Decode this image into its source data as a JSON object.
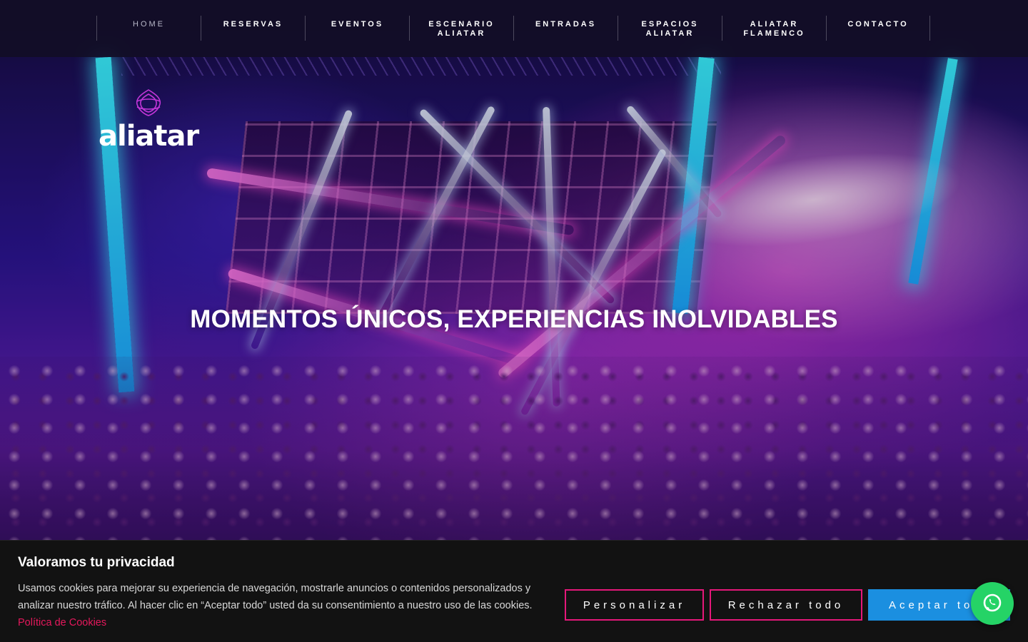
{
  "nav": {
    "items": [
      {
        "label": "HOME",
        "active": true
      },
      {
        "label": "RESERVAS",
        "active": false
      },
      {
        "label": "EVENTOS",
        "active": false
      },
      {
        "label": "ESCENARIO\nALIATAR",
        "active": false
      },
      {
        "label": "ENTRADAS",
        "active": false
      },
      {
        "label": "ESPACIOS\nALIATAR",
        "active": false
      },
      {
        "label": "ALIATAR\nFLAMENCO",
        "active": false
      },
      {
        "label": "CONTACTO",
        "active": false
      }
    ]
  },
  "logo": {
    "text": "aliatar",
    "mark_color": "#c236d8"
  },
  "hero": {
    "headline": "MOMENTOS ÚNICOS, EXPERIENCIAS INOLVIDABLES",
    "icon": "dance-club-photo"
  },
  "cookie_banner": {
    "title": "Valoramos tu privacidad",
    "text": "Usamos cookies para mejorar su experiencia de navegación, mostrarle anuncios o contenidos personalizados y analizar nuestro tráfico. Al hacer clic en “Aceptar todo” usted da su consentimiento a nuestro uso de las cookies.",
    "link": "Política de Cookies",
    "buttons": {
      "customize": "Personalizar",
      "reject": "Rechazar todo",
      "accept": "Aceptar todo"
    },
    "accent": "#e5187a",
    "accept_color": "#1b8fe0"
  },
  "whatsapp": {
    "icon": "whatsapp-icon",
    "color": "#25d366"
  }
}
